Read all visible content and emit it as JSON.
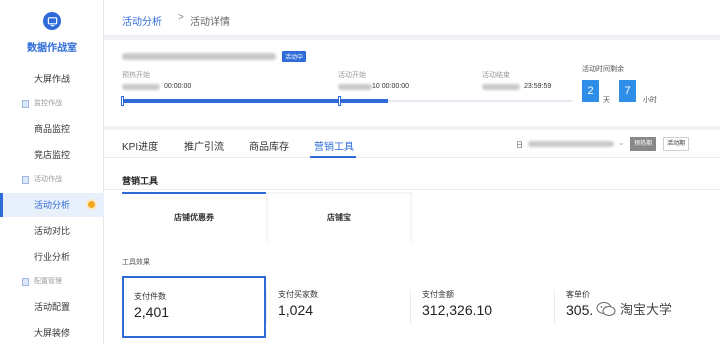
{
  "sidebar": {
    "brand": "数据作战室",
    "big_screen": "大屏作战",
    "groups": {
      "monitor": "监控作战",
      "activity": "活动作战",
      "config": "配置管理"
    },
    "items": {
      "product_monitor": "商品监控",
      "competitor_monitor": "竞店监控",
      "activity_analysis": "活动分析",
      "activity_compare": "活动对比",
      "industry_analysis": "行业分析",
      "activity_config": "活动配置",
      "screen_decor": "大屏装修"
    }
  },
  "breadcrumb": {
    "root": "活动分析",
    "sep": ">",
    "current": "活动详情"
  },
  "activity": {
    "status": "活动中",
    "timeline": [
      {
        "label": "预热开始",
        "value": "00:00:00"
      },
      {
        "label": "活动开始",
        "value": "10 00:00:00"
      },
      {
        "label": "活动结束",
        "value": "23:59:59"
      }
    ],
    "progress": 0.59,
    "remaining": {
      "title": "活动时间剩余",
      "days": "2",
      "days_unit": "天",
      "hours": "7",
      "hours_unit": "小时"
    }
  },
  "tabs": [
    "KPI进度",
    "推广引流",
    "商品库存",
    "营销工具"
  ],
  "date_label": "日",
  "period_buttons": [
    "预热期",
    "活动期"
  ],
  "section": {
    "title": "营销工具",
    "tools": [
      "店铺优惠券",
      "店铺宝"
    ],
    "effect_label": "工具效果",
    "metrics": [
      {
        "label": "支付件数",
        "value": "2,401"
      },
      {
        "label": "支付买家数",
        "value": "1,024"
      },
      {
        "label": "支付金额",
        "value": "312,326.10"
      },
      {
        "label": "客单价",
        "value": "305."
      }
    ]
  },
  "watermark": "淘宝大学",
  "colors": {
    "accent": "#2e6bd9",
    "countdown": "#2e8ee8",
    "notify": "#f5a623"
  }
}
